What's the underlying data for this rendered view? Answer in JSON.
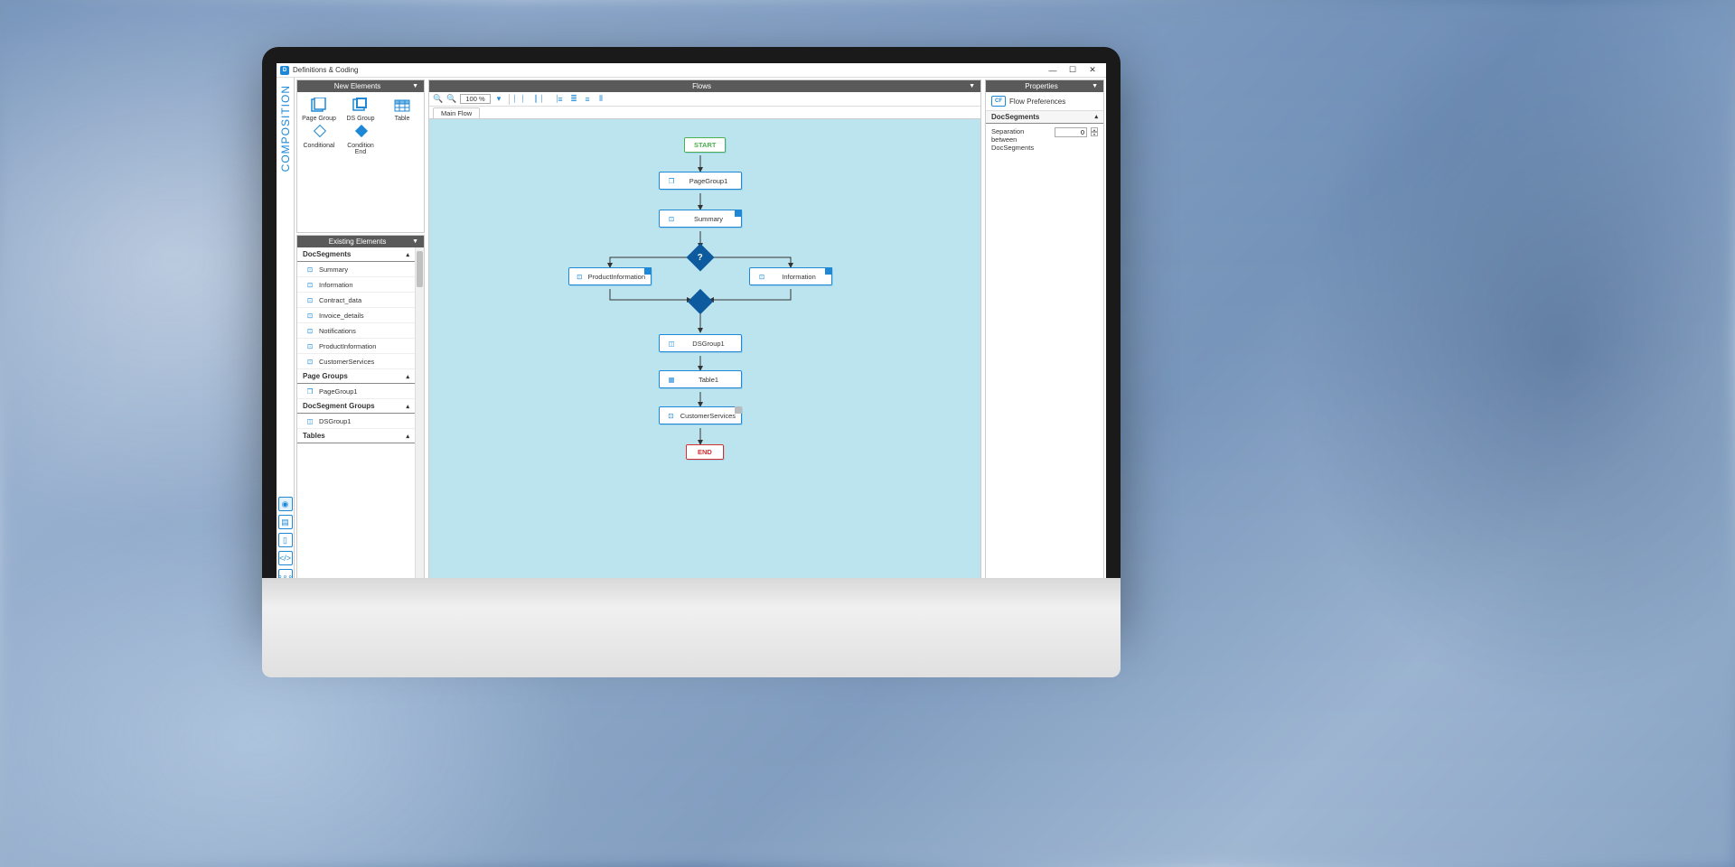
{
  "window": {
    "title": "Definitions & Coding",
    "min": "—",
    "max": "☐",
    "close": "✕"
  },
  "leftRail": {
    "label": "COMPOSITION",
    "icons": [
      "eye-icon",
      "layers-icon",
      "doc-icon",
      "code-icon",
      "more-icon"
    ]
  },
  "newElements": {
    "title": "New Elements",
    "items": [
      {
        "label": "Page Group",
        "icon": "page-group-icon"
      },
      {
        "label": "DS Group",
        "icon": "ds-group-icon"
      },
      {
        "label": "Table",
        "icon": "table-icon"
      },
      {
        "label": "Conditional",
        "icon": "conditional-icon"
      },
      {
        "label": "Condition End",
        "icon": "condition-end-icon"
      }
    ]
  },
  "existingElements": {
    "title": "Existing Elements",
    "categories": [
      {
        "name": "DocSegments",
        "items": [
          "Summary",
          "Information",
          "Contract_data",
          "Invoice_details",
          "Notifications",
          "ProductInformation",
          "CustomerServices"
        ]
      },
      {
        "name": "Page Groups",
        "items": [
          "PageGroup1"
        ]
      },
      {
        "name": "DocSegment Groups",
        "items": [
          "DSGroup1"
        ]
      },
      {
        "name": "Tables",
        "items": []
      }
    ]
  },
  "flows": {
    "title": "Flows",
    "zoom": "100 %",
    "tab": "Main Flow",
    "nodes": {
      "start": "START",
      "pageGroup1": "PageGroup1",
      "summary": "Summary",
      "productInfo": "ProductInformation",
      "information": "Information",
      "dsGroup1": "DSGroup1",
      "table1": "Table1",
      "custServices": "CustomerServices",
      "end": "END"
    }
  },
  "properties": {
    "title": "Properties",
    "prefLabel": "Flow Preferences",
    "section": "DocSegments",
    "sepLabel": "Separation between DocSegments",
    "sepValue": "0"
  }
}
